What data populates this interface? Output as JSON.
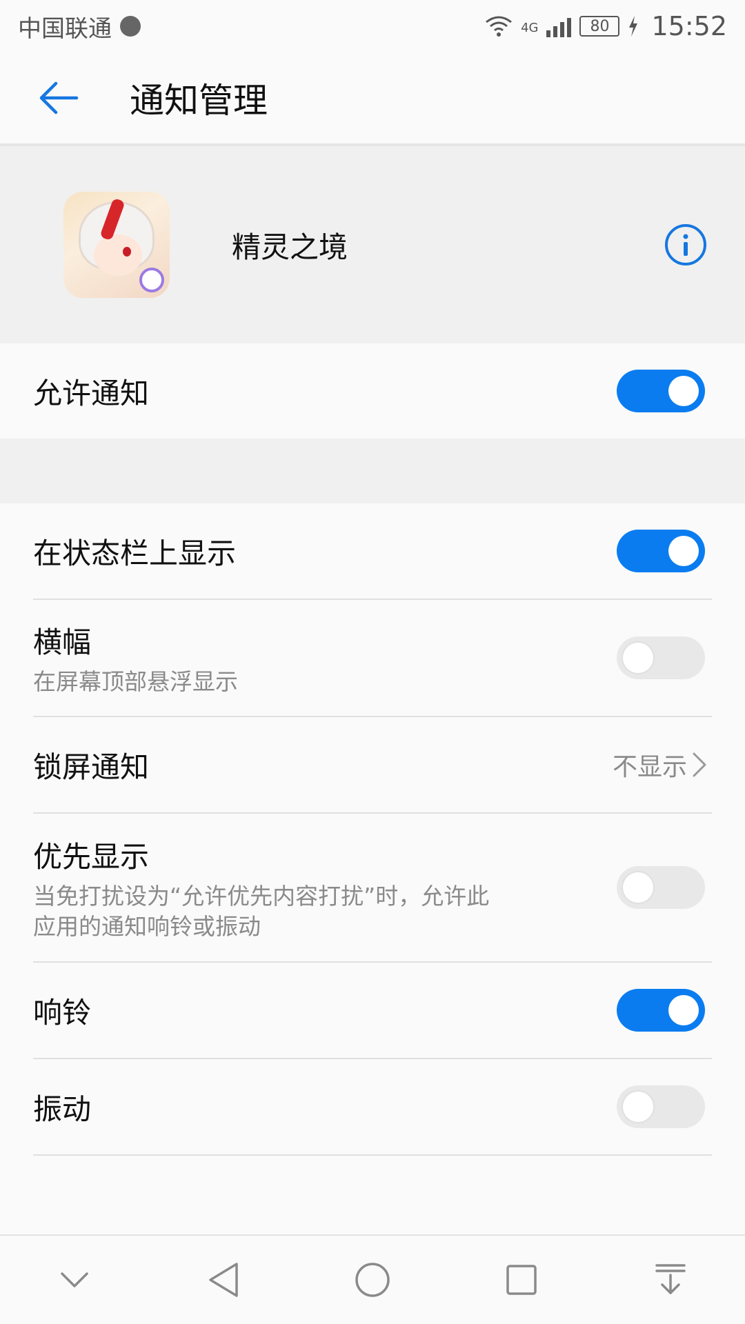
{
  "status_bar": {
    "carrier": "中国联通",
    "network": "4G",
    "battery": "80",
    "time": "15:52"
  },
  "header": {
    "title": "通知管理",
    "back_icon": "back-arrow-icon"
  },
  "app": {
    "name": "精灵之境",
    "info_icon": "info-icon"
  },
  "rows": {
    "allow_notifications": {
      "title": "允许通知",
      "on": true
    },
    "status_bar_display": {
      "title": "在状态栏上显示",
      "on": true
    },
    "banner": {
      "title": "横幅",
      "subtitle": "在屏幕顶部悬浮显示",
      "on": false
    },
    "lock_screen": {
      "title": "锁屏通知",
      "value": "不显示"
    },
    "priority": {
      "title": "优先显示",
      "subtitle_line1": "当免打扰设为“允许优先内容打扰”时，允许此",
      "subtitle_line2": "应用的通知响铃或振动",
      "on": false
    },
    "ring": {
      "title": "响铃",
      "on": true
    },
    "vibrate": {
      "title": "振动",
      "on": false
    }
  },
  "colors": {
    "accent": "#0a7cf0",
    "toggle_off": "#e8e8e8",
    "band": "#f0f0f0"
  },
  "nav": [
    "chevron-down-icon",
    "back-triangle-icon",
    "home-circle-icon",
    "recents-square-icon",
    "notification-pull-icon"
  ]
}
